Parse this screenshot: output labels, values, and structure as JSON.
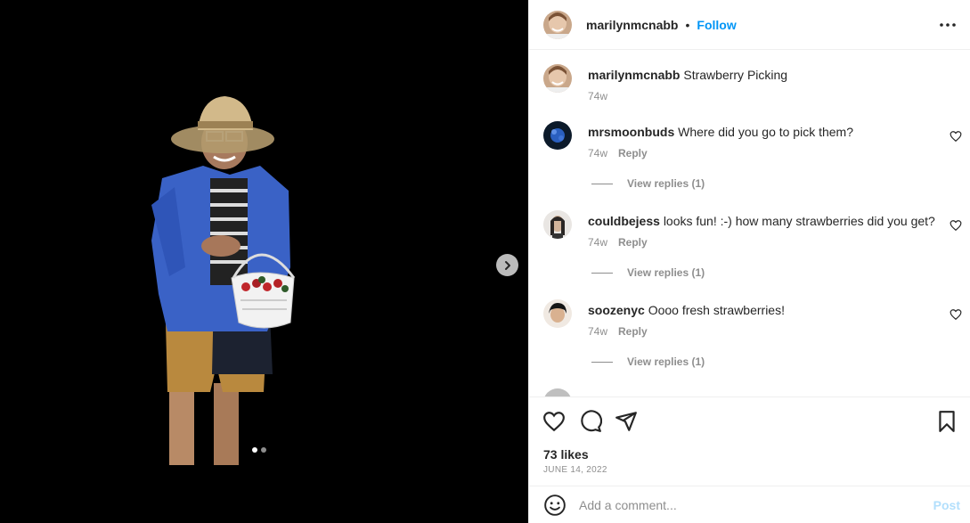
{
  "post": {
    "author": "marilynmcnabb",
    "follow_label": "Follow",
    "separator": "•",
    "caption": {
      "user": "marilynmcnabb",
      "text": "Strawberry Picking",
      "age": "74w"
    },
    "comments": [
      {
        "user": "mrsmoonbuds",
        "text": "Where did you go to pick them?",
        "age": "74w",
        "reply_label": "Reply",
        "view_replies": "View replies (1)"
      },
      {
        "user": "couldbejess",
        "text": "looks fun! :-) how many strawberries did you get?",
        "age": "74w",
        "reply_label": "Reply",
        "view_replies": "View replies (1)"
      },
      {
        "user": "soozenyc",
        "text": "Oooo fresh strawberries!",
        "age": "74w",
        "reply_label": "Reply",
        "view_replies": "View replies (1)"
      }
    ],
    "likes": "73 likes",
    "date": "JUNE 14, 2022",
    "carousel": {
      "current": 1,
      "total": 2
    }
  },
  "composer": {
    "placeholder": "Add a comment...",
    "post_label": "Post"
  },
  "colors": {
    "accent": "#0095f6",
    "post_disabled": "#b2dffc",
    "muted": "#8e8e8e"
  },
  "icons": {
    "like": "heart-icon",
    "comment": "comment-icon",
    "share": "share-icon",
    "save": "bookmark-icon",
    "more": "more-options-icon",
    "next": "chevron-right-icon",
    "emoji": "emoji-icon"
  }
}
